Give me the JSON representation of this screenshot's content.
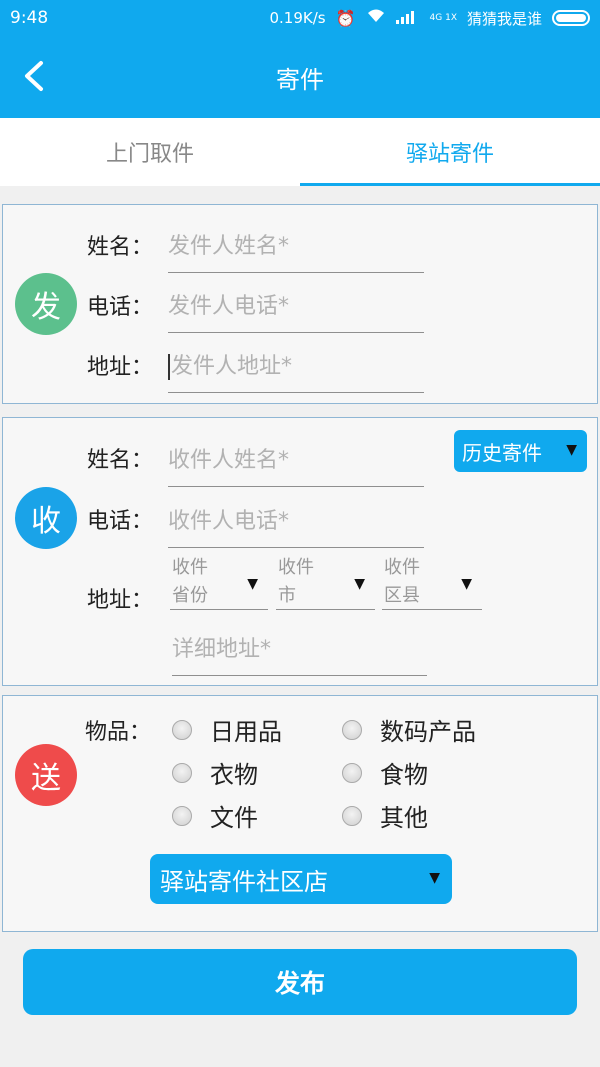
{
  "status": {
    "time": "9:48",
    "speed": "0.19K/s",
    "network_small": "4G 1X",
    "carrier": "猜猜我是谁",
    "icons": [
      "alarm-icon",
      "wifi-icon",
      "signal-icon",
      "battery-icon"
    ]
  },
  "header": {
    "title": "寄件",
    "back_icon": "back-chevron-icon"
  },
  "tabs": [
    {
      "label": "上门取件",
      "active": false
    },
    {
      "label": "驿站寄件",
      "active": true
    }
  ],
  "sender": {
    "badge": "发",
    "badge_color": "#5cc08d",
    "name_label": "姓名：",
    "name_placeholder": "发件人姓名*",
    "phone_label": "电话：",
    "phone_placeholder": "发件人电话*",
    "address_label": "地址：",
    "address_placeholder": "发件人地址*"
  },
  "receiver": {
    "badge": "收",
    "badge_color": "#1aa3e8",
    "history_button": "历史寄件",
    "name_label": "姓名：",
    "name_placeholder": "收件人姓名*",
    "phone_label": "电话：",
    "phone_placeholder": "收件人电话*",
    "address_label": "地址：",
    "province": {
      "line1": "收件",
      "line2": "省份"
    },
    "city": {
      "line1": "收件",
      "line2": "市"
    },
    "district": {
      "line1": "收件",
      "line2": "区县"
    },
    "detail_placeholder": "详细地址*"
  },
  "items": {
    "badge": "送",
    "badge_color": "#ef4b4b",
    "label": "物品：",
    "options": [
      "日用品",
      "数码产品",
      "衣物",
      "食物",
      "文件",
      "其他"
    ],
    "station_select": "驿站寄件社区店"
  },
  "publish_button": "发布"
}
